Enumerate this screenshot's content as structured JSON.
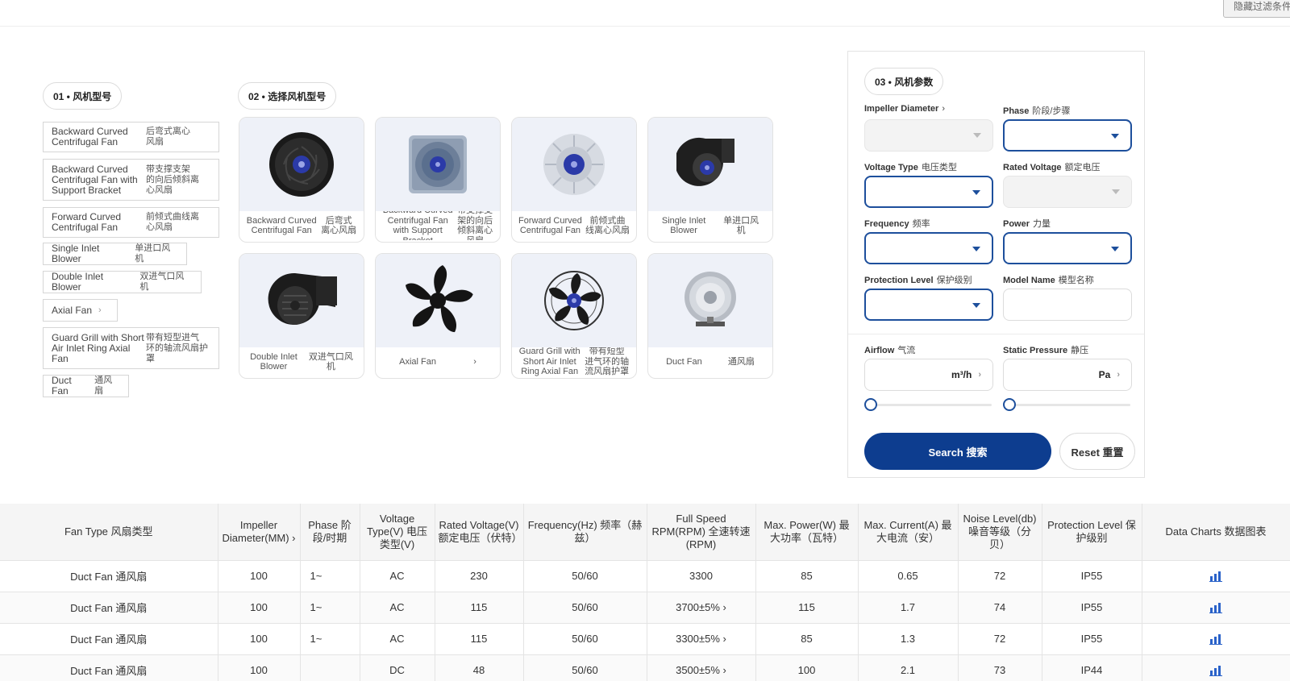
{
  "corner_button": {
    "label": "隐藏过滤条件"
  },
  "section1": {
    "title": "01 • 风机型号",
    "items": [
      {
        "en": "Backward Curved\nCentrifugal Fan",
        "zh": "后弯式离心\n风扇",
        "chev": ""
      },
      {
        "en": "Backward Curved\nCentrifugal Fan with\nSupport Bracket",
        "zh": "带支撑支架\n的向后倾斜离\n心风扇",
        "chev": ""
      },
      {
        "en": "Forward Curved\nCentrifugal Fan",
        "zh": "前倾式曲线离\n心风扇",
        "chev": ""
      },
      {
        "en": "Single Inlet Blower",
        "zh": "单进口风机",
        "chev": ""
      },
      {
        "en": "Double Inlet Blower",
        "zh": "双进气口风机",
        "chev": ""
      },
      {
        "en": "Axial Fan",
        "zh": "",
        "chev": "›"
      },
      {
        "en": "Guard Grill with Short\nAir Inlet Ring Axial\nFan",
        "zh": "带有短型进气\n环的轴流风扇护\n罩",
        "chev": ""
      },
      {
        "en": "Duct Fan",
        "zh": "通风扇",
        "chev": ""
      }
    ]
  },
  "section2": {
    "title": "02 • 选择风机型号",
    "cards": [
      {
        "en": "Backward Curved\nCentrifugal Fan",
        "zh": "后弯式\n离心风扇",
        "icon": "backward-curved-fan-icon"
      },
      {
        "en": "Backward Curved\nCentrifugal Fan\nwith Support\nBracket",
        "zh": "带支撑支\n架的向后\n倾斜离心\n风扇",
        "icon": "backward-curved-bracket-fan-icon"
      },
      {
        "en": "Forward Curved\nCentrifugal Fan",
        "zh": "前倾式曲\n线离心风扇",
        "icon": "forward-curved-fan-icon"
      },
      {
        "en": "Single Inlet\nBlower",
        "zh": "单进口风\n机",
        "icon": "single-inlet-blower-icon"
      },
      {
        "en": "Double Inlet\nBlower",
        "zh": "双进气口风\n机",
        "icon": "double-inlet-blower-icon"
      },
      {
        "en": "Axial Fan",
        "zh": "›",
        "icon": "axial-fan-icon"
      },
      {
        "en": "Guard Grill with\nShort Air Inlet\nRing Axial Fan",
        "zh": "带有短型\n进气环的轴\n流风扇护罩",
        "icon": "guard-grill-fan-icon"
      },
      {
        "en": "Duct Fan",
        "zh": "通风扇",
        "icon": "duct-fan-icon"
      }
    ]
  },
  "section3": {
    "title": "03 • 风机参数",
    "fields": {
      "impeller": {
        "label": "Impeller Diameter",
        "zh": "›"
      },
      "phase": {
        "label": "Phase",
        "zh": "阶段/步骤"
      },
      "voltage_type": {
        "label": "Voltage Type",
        "zh": "电压类型"
      },
      "rated_voltage": {
        "label": "Rated Voltage",
        "zh": "额定电压"
      },
      "frequency": {
        "label": "Frequency",
        "zh": "频率"
      },
      "power": {
        "label": "Power",
        "zh": "力量"
      },
      "protection": {
        "label": "Protection Level",
        "zh": "保护级别"
      },
      "model": {
        "label": "Model Name",
        "zh": "模型名称"
      },
      "airflow": {
        "label": "Airflow",
        "zh": "气流",
        "unit": "m³/h"
      },
      "pressure": {
        "label": "Static Pressure",
        "zh": "静压",
        "unit": "Pa"
      }
    },
    "search_label": "Search  搜索",
    "reset_label": "Reset  重置"
  },
  "table": {
    "headers": [
      "Fan Type  风扇类型",
      "Impeller Diameter(MM) ›",
      "Phase  阶段/时期",
      "Voltage Type(V)  电压类型(V)",
      "Rated Voltage(V)  额定电压（伏特）",
      "Frequency(Hz)  频率（赫兹）",
      "Full Speed RPM(RPM)  全速转速(RPM)",
      "Max. Power(W)  最大功率（瓦特）",
      "Max. Current(A)  最大电流（安）",
      "Noise Level(db)  噪音等级（分贝）",
      "Protection Level  保护级别",
      "Data Charts  数据图表"
    ],
    "rows": [
      [
        "Duct Fan  通风扇",
        "100",
        "1~",
        "AC",
        "230",
        "50/60",
        "3300",
        "85",
        "0.65",
        "72",
        "IP55"
      ],
      [
        "Duct Fan  通风扇",
        "100",
        "1~",
        "AC",
        "115",
        "50/60",
        "3700±5%  ›",
        "115",
        "1.7",
        "74",
        "IP55"
      ],
      [
        "Duct Fan  通风扇",
        "100",
        "1~",
        "AC",
        "115",
        "50/60",
        "3300±5%  ›",
        "85",
        "1.3",
        "72",
        "IP55"
      ],
      [
        "Duct Fan  通风扇",
        "100",
        "",
        "DC",
        "48",
        "50/60",
        "3500±5%  ›",
        "100",
        "2.1",
        "73",
        "IP44"
      ]
    ]
  }
}
